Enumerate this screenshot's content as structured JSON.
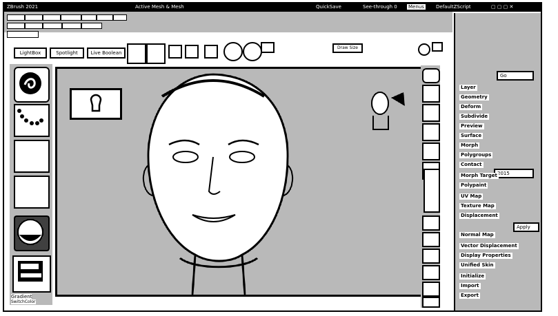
{
  "window": {
    "title_left": "ZBrush 2021",
    "title_mid": "Active Mesh & Mesh",
    "title_right": "QuickSave",
    "see_through_label": "See-through 0",
    "menus_label": "Menus",
    "script_label": "DefaultZScript"
  },
  "toolbar": {
    "lightbox_label": "LightBox",
    "spotlight_label": "Spotlight",
    "live_boolean_label": "Live Boolean",
    "draw_size_label": "Draw Size"
  },
  "left_shelf": {
    "gradient_label": "Gradient",
    "switch_color_label": "SwitchColor"
  },
  "right_panel": {
    "items": [
      "Layer",
      "Geometry",
      "Deform",
      "Subdivide",
      "Preview",
      "Surface",
      "Morph",
      "Polygroups",
      "Contact",
      "Morph Target",
      "Polypaint",
      "UV Map",
      "Texture Map",
      "Displacement",
      "Normal Map",
      "Vector Displacement",
      "Display Properties",
      "Unified Skin",
      "Initialize",
      "Import",
      "Export"
    ],
    "boxes": {
      "go_label": "Go",
      "count_label": "2015",
      "apply_label": "Apply"
    }
  },
  "canvas": {
    "lock_icon": "lock-icon",
    "head_icon": "head-navigation-icon"
  }
}
